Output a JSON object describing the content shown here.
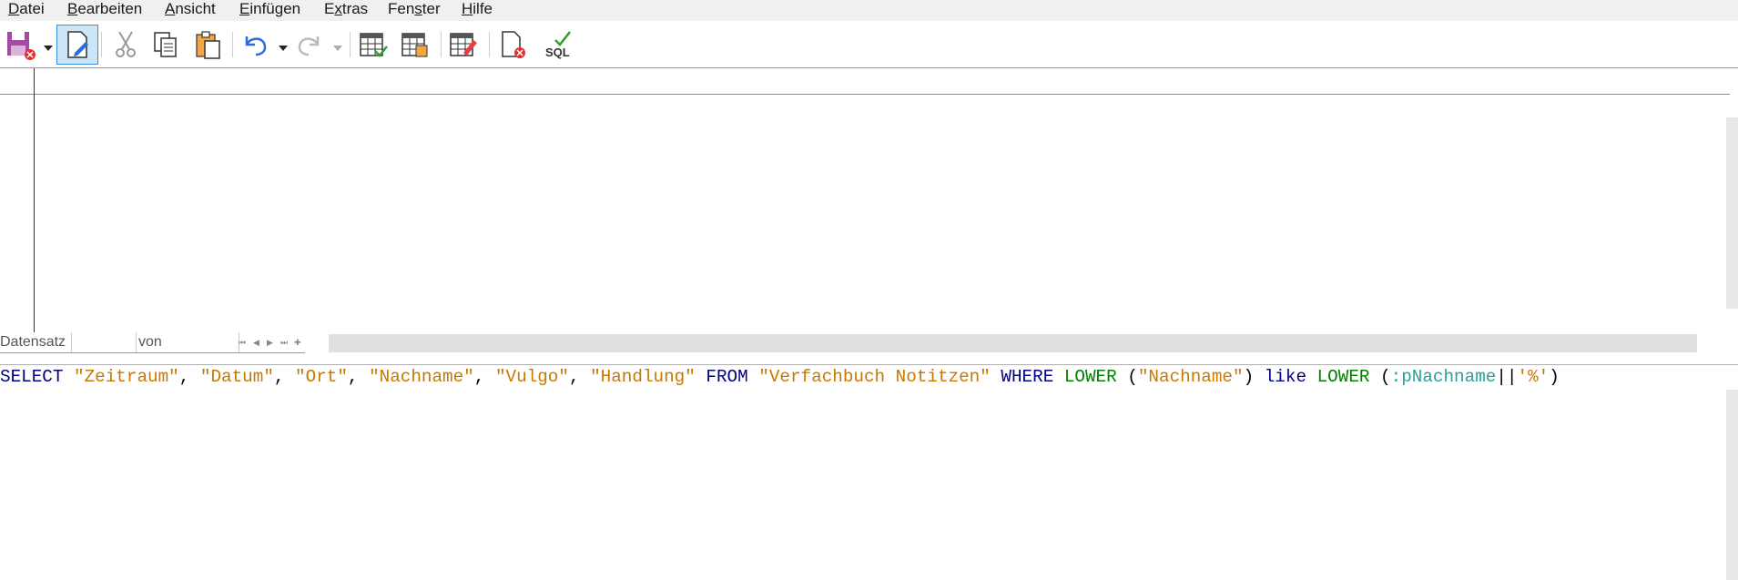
{
  "menu": {
    "items": [
      {
        "mnemonic": "D",
        "rest": "atei"
      },
      {
        "mnemonic": "B",
        "rest": "earbeiten"
      },
      {
        "mnemonic": "A",
        "rest": "nsicht"
      },
      {
        "mnemonic": "E",
        "rest": "infügen"
      },
      {
        "mnemonic": "x",
        "pre": "E",
        "rest": "tras"
      },
      {
        "pre": "Fen",
        "mnemonic": "s",
        "rest": "ter"
      },
      {
        "mnemonic": "H",
        "rest": "ilfe"
      }
    ]
  },
  "toolbar": {
    "icons": [
      "save-icon",
      "edit-mode-icon",
      "cut-icon",
      "copy-icon",
      "paste-icon",
      "undo-icon",
      "redo-icon",
      "run-query-icon",
      "clear-query-icon",
      "add-table-icon",
      "close-design-icon",
      "sql-mode-icon"
    ]
  },
  "navigation": {
    "record_label": "Datensatz",
    "of_label": "von",
    "buttons": [
      "⏮",
      "◀",
      "▶",
      "⏭",
      "✚"
    ]
  },
  "sql": {
    "tokens": [
      {
        "t": "SELECT",
        "c": "kw"
      },
      {
        "t": " ",
        "c": "pl"
      },
      {
        "t": "\"Zeitraum\"",
        "c": "str"
      },
      {
        "t": ", ",
        "c": "pl"
      },
      {
        "t": "\"Datum\"",
        "c": "str"
      },
      {
        "t": ", ",
        "c": "pl"
      },
      {
        "t": "\"Ort\"",
        "c": "str"
      },
      {
        "t": ", ",
        "c": "pl"
      },
      {
        "t": "\"Nachname\"",
        "c": "str"
      },
      {
        "t": ", ",
        "c": "pl"
      },
      {
        "t": "\"Vulgo\"",
        "c": "str"
      },
      {
        "t": ", ",
        "c": "pl"
      },
      {
        "t": "\"Handlung\"",
        "c": "str"
      },
      {
        "t": " ",
        "c": "pl"
      },
      {
        "t": "FROM",
        "c": "kw"
      },
      {
        "t": " ",
        "c": "pl"
      },
      {
        "t": "\"Verfachbuch Notitzen\"",
        "c": "str"
      },
      {
        "t": " ",
        "c": "pl"
      },
      {
        "t": "WHERE",
        "c": "kw"
      },
      {
        "t": " ",
        "c": "pl"
      },
      {
        "t": "LOWER",
        "c": "fn"
      },
      {
        "t": " (",
        "c": "pl"
      },
      {
        "t": "\"Nachname\"",
        "c": "str"
      },
      {
        "t": ") ",
        "c": "pl"
      },
      {
        "t": "like",
        "c": "kw"
      },
      {
        "t": " ",
        "c": "pl"
      },
      {
        "t": "LOWER",
        "c": "fn"
      },
      {
        "t": " (",
        "c": "pl"
      },
      {
        "t": ":pNachname",
        "c": "param"
      },
      {
        "t": "||",
        "c": "pl"
      },
      {
        "t": "'%'",
        "c": "str"
      },
      {
        "t": ")",
        "c": "pl"
      }
    ]
  },
  "colors": {
    "keyword": "#000080",
    "string": "#c87800",
    "function": "#008000",
    "parameter": "#2aa198"
  }
}
